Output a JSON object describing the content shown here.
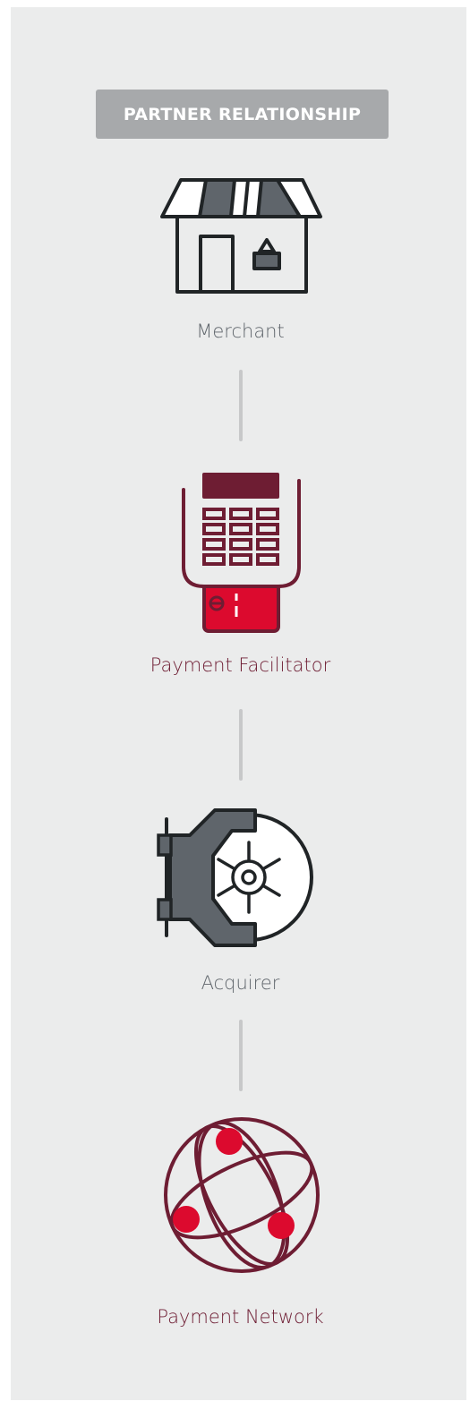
{
  "header": {
    "title": "PARTNER RELATIONSHIP"
  },
  "nodes": [
    {
      "label": "Merchant",
      "icon": "storefront-icon",
      "color": "#5f656b"
    },
    {
      "label": "Payment Facilitator",
      "icon": "card-terminal-icon",
      "color": "#6e1d33"
    },
    {
      "label": "Acquirer",
      "icon": "bank-vault-icon",
      "color": "#5f656b"
    },
    {
      "label": "Payment Network",
      "icon": "globe-network-icon",
      "color": "#6e1d33"
    }
  ],
  "colors": {
    "panel": "#ebecec",
    "badge": "#a7a9ab",
    "dark": "#202426",
    "slate": "#5f656b",
    "maroon": "#6e1d33",
    "red": "#dc0a2e",
    "connector": "#c7c8c9"
  }
}
